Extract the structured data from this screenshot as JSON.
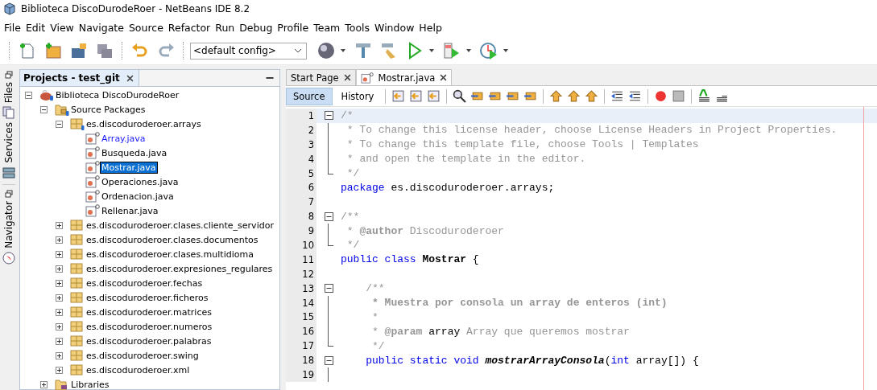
{
  "window": {
    "title": "Biblioteca DiscoDurodeRoer - NetBeans IDE 8.2"
  },
  "menu": [
    "File",
    "Edit",
    "View",
    "Navigate",
    "Source",
    "Refactor",
    "Run",
    "Debug",
    "Profile",
    "Team",
    "Tools",
    "Window",
    "Help"
  ],
  "toolbar": {
    "config": "<default config>"
  },
  "side_tabs": [
    {
      "label": "Files",
      "kind": "files"
    },
    {
      "label": "Services",
      "kind": "services"
    },
    {
      "label": "Navigator",
      "kind": "navigator"
    }
  ],
  "projects_panel": {
    "title": "Projects - test_git",
    "tree": [
      {
        "label": "Biblioteca DiscoDurodeRoer",
        "kind": "project",
        "expanded": true,
        "children": [
          {
            "label": "Source Packages",
            "kind": "sources",
            "expanded": true,
            "children": [
              {
                "label": "es.discoduroderoer.arrays",
                "kind": "package",
                "expanded": true,
                "children": [
                  {
                    "label": "Array.java",
                    "kind": "java",
                    "selected": false,
                    "modified": true
                  },
                  {
                    "label": "Busqueda.java",
                    "kind": "java",
                    "selected": false,
                    "modified": false
                  },
                  {
                    "label": "Mostrar.java",
                    "kind": "java",
                    "selected": true,
                    "modified": false
                  },
                  {
                    "label": "Operaciones.java",
                    "kind": "java",
                    "selected": false,
                    "modified": false
                  },
                  {
                    "label": "Ordenacion.java",
                    "kind": "java",
                    "selected": false,
                    "modified": false
                  },
                  {
                    "label": "Rellenar.java",
                    "kind": "java",
                    "selected": false,
                    "modified": false
                  }
                ]
              },
              {
                "label": "es.discoduroderoer.clases.cliente_servidor",
                "kind": "package",
                "expanded": false
              },
              {
                "label": "es.discoduroderoer.clases.documentos",
                "kind": "package",
                "expanded": false
              },
              {
                "label": "es.discoduroderoer.clases.multidioma",
                "kind": "package",
                "expanded": false
              },
              {
                "label": "es.discoduroderoer.expresiones_regulares",
                "kind": "package",
                "expanded": false
              },
              {
                "label": "es.discoduroderoer.fechas",
                "kind": "package",
                "expanded": false
              },
              {
                "label": "es.discoduroderoer.ficheros",
                "kind": "package",
                "expanded": false
              },
              {
                "label": "es.discoduroderoer.matrices",
                "kind": "package",
                "expanded": false
              },
              {
                "label": "es.discoduroderoer.numeros",
                "kind": "package",
                "expanded": false
              },
              {
                "label": "es.discoduroderoer.palabras",
                "kind": "package",
                "expanded": false
              },
              {
                "label": "es.discoduroderoer.swing",
                "kind": "package",
                "expanded": false
              },
              {
                "label": "es.discoduroderoer.xml",
                "kind": "package",
                "expanded": false
              }
            ]
          },
          {
            "label": "Libraries",
            "kind": "libraries",
            "expanded": false
          }
        ]
      }
    ]
  },
  "editor_tabs": [
    {
      "label": "Start Page",
      "selected": false
    },
    {
      "label": "Mostrar.java",
      "selected": true
    }
  ],
  "view_tabs": [
    {
      "label": "Source",
      "selected": true
    },
    {
      "label": "History",
      "selected": false
    }
  ],
  "code": [
    {
      "n": "1",
      "fold_start": true,
      "current": true,
      "seg": [
        {
          "t": "/*",
          "kind": "comment"
        }
      ]
    },
    {
      "n": "2",
      "seg": [
        {
          "t": " * To change this license header, choose License Headers in Project Properties.",
          "kind": "comment"
        }
      ]
    },
    {
      "n": "3",
      "seg": [
        {
          "t": " * To change this template file, choose Tools | Templates",
          "kind": "comment"
        }
      ]
    },
    {
      "n": "4",
      "seg": [
        {
          "t": " * and open the template in the editor.",
          "kind": "comment"
        }
      ]
    },
    {
      "n": "5",
      "fold_end": true,
      "seg": [
        {
          "t": " */",
          "kind": "comment"
        }
      ]
    },
    {
      "n": "6",
      "seg": [
        {
          "t": "package ",
          "kind": "keyword"
        },
        {
          "t": "es.discoduroderoer.arrays;",
          "kind": "plain"
        }
      ]
    },
    {
      "n": "7"
    },
    {
      "n": "8",
      "fold_start": true,
      "seg": [
        {
          "t": "/**",
          "kind": "comment"
        }
      ]
    },
    {
      "n": "9",
      "seg": [
        {
          "t": " * ",
          "kind": "comment"
        },
        {
          "t": "@author",
          "kind": "docbold"
        },
        {
          "t": " Discoduroderoer",
          "kind": "comment"
        }
      ]
    },
    {
      "n": "10",
      "fold_end": true,
      "seg": [
        {
          "t": " */",
          "kind": "comment"
        }
      ]
    },
    {
      "n": "11",
      "seg": [
        {
          "t": "public class ",
          "kind": "keyword"
        },
        {
          "t": "Mostrar",
          "kind": "bold"
        },
        {
          "t": " {",
          "kind": "plain"
        }
      ]
    },
    {
      "n": "12"
    },
    {
      "n": "13",
      "fold_start": true,
      "seg": [
        {
          "t": "    /**",
          "kind": "comment"
        }
      ]
    },
    {
      "n": "14",
      "seg": [
        {
          "t": "     * Muestra por consola un array de enteros (int)",
          "kind": "docbold"
        }
      ]
    },
    {
      "n": "15",
      "seg": [
        {
          "t": "     *",
          "kind": "comment"
        }
      ]
    },
    {
      "n": "16",
      "seg": [
        {
          "t": "     * ",
          "kind": "comment"
        },
        {
          "t": "@param",
          "kind": "docbold"
        },
        {
          "t": " array",
          "kind": "plain"
        },
        {
          "t": " Array que queremos mostrar",
          "kind": "comment"
        }
      ]
    },
    {
      "n": "17",
      "fold_end": true,
      "seg": [
        {
          "t": "     */",
          "kind": "comment"
        }
      ]
    },
    {
      "n": "18",
      "fold_start": true,
      "seg": [
        {
          "t": "    public static void ",
          "kind": "keyword"
        },
        {
          "t": "mostrarArrayConsola",
          "kind": "method"
        },
        {
          "t": "(",
          "kind": "plain"
        },
        {
          "t": "int",
          "kind": "keyword"
        },
        {
          "t": " array[]) {",
          "kind": "plain"
        }
      ]
    },
    {
      "n": "19"
    }
  ]
}
